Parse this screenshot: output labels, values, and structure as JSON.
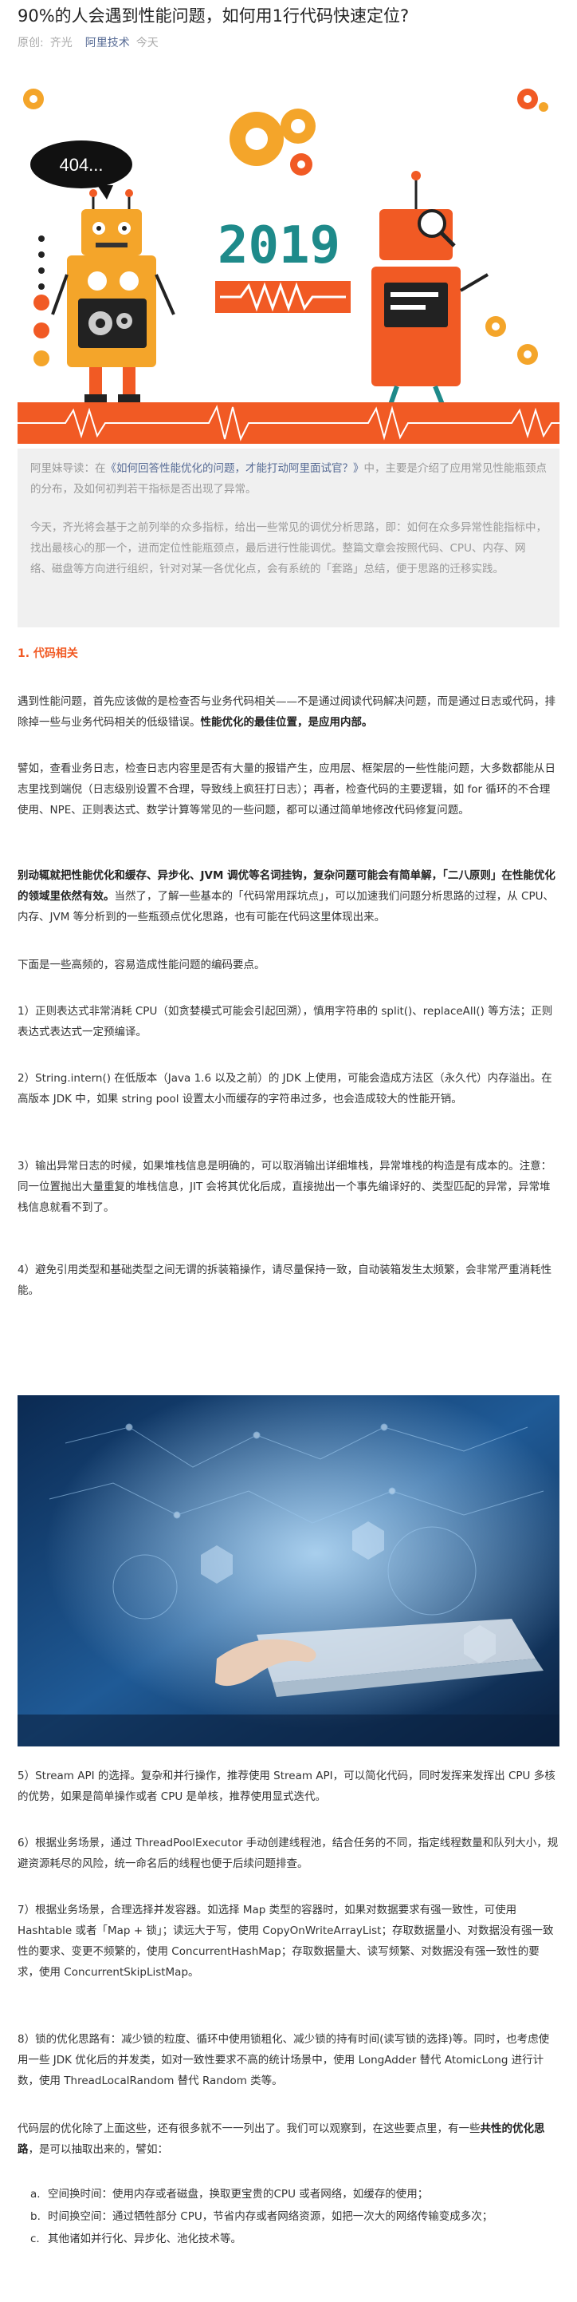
{
  "article": {
    "title": "90%的人会遇到性能问题，如何用1行代码快速定位?",
    "meta_label": "原创:",
    "author": "齐光",
    "account": "阿里技术",
    "date": "今天"
  },
  "hero": {
    "bubble": "404...",
    "year": "2019"
  },
  "intro": {
    "p1_prefix": "阿里妹导读：在",
    "p1_link": "《如何回答性能优化的问题，才能打动阿里面试官？》",
    "p1_suffix": "中，主要是介绍了应用常见性能瓶颈点的分布，及如何初判若干指标是否出现了异常。",
    "p2": "今天，齐光将会基于之前列举的众多指标，给出一些常见的调优分析思路，即：如何在众多异常性能指标中，找出最核心的那一个，进而定位性能瓶颈点，最后进行性能调优。整篇文章会按照代码、CPU、内存、网络、磁盘等方向进行组织，针对对某一各优化点，会有系统的「套路」总结，便于思路的迁移实践。"
  },
  "section1": {
    "heading": "1. 代码相关",
    "p1_a": "遇到性能问题，首先应该做的是检查否与业务代码相关——不是通过阅读代码解决问题，而是通过日志或代码，排除掉一些与业务代码相关的低级错误。",
    "p1_b": "性能优化的最佳位置，是应用内部。",
    "p2": "譬如，查看业务日志，检查日志内容里是否有大量的报错产生，应用层、框架层的一些性能问题，大多数都能从日志里找到端倪（日志级别设置不合理，导致线上疯狂打日志）；再者，检查代码的主要逻辑，如 for 循环的不合理使用、NPE、正则表达式、数学计算等常见的一些问题，都可以通过简单地修改代码修复问题。",
    "p3_a": "别动辄就把性能优化和缓存、异步化、JVM 调优等名词挂钩，复杂问题可能会有简单解，「二八原则」在性能优化的领域里依然有效。",
    "p3_b": "当然了，了解一些基本的「代码常用踩坑点」，可以加速我们问题分析思路的过程，从 CPU、内存、JVM 等分析到的一些瓶颈点优化思路，也有可能在代码这里体现出来。",
    "p4": "下面是一些高频的，容易造成性能问题的编码要点。",
    "i1": "1）正则表达式非常消耗 CPU（如贪婪模式可能会引起回溯），慎用字符串的 split()、replaceAll() 等方法；正则表达式表达式一定预编译。",
    "i2": "2）String.intern() 在低版本（Java 1.6 以及之前）的 JDK 上使用，可能会造成方法区（永久代）内存溢出。在高版本 JDK 中，如果 string pool 设置太小而缓存的字符串过多，也会造成较大的性能开销。",
    "i3": "3）输出异常日志的时候，如果堆栈信息是明确的，可以取消输出详细堆栈，异常堆栈的构造是有成本的。注意：同一位置抛出大量重复的堆栈信息，JIT 会将其优化后成，直接抛出一个事先编译好的、类型匹配的异常，异常堆栈信息就看不到了。",
    "i4": "4）避免引用类型和基础类型之间无谓的拆装箱操作，请尽量保持一致，自动装箱发生太频繁，会非常严重消耗性能。",
    "i5": "5）Stream API 的选择。复杂和并行操作，推荐使用 Stream API，可以简化代码，同时发挥来发挥出 CPU 多核的优势，如果是简单操作或者 CPU 是单核，推荐使用显式迭代。",
    "i6": "6）根据业务场景，通过 ThreadPoolExecutor 手动创建线程池，结合任务的不同，指定线程数量和队列大小，规避资源耗尽的风险，统一命名后的线程也便于后续问题排查。",
    "i7": "7）根据业务场景，合理选择并发容器。如选择 Map 类型的容器时，如果对数据要求有强一致性，可使用 Hashtable 或者「Map + 锁」；读远大于写，使用 CopyOnWriteArrayList；存取数据量小、对数据没有强一致性的要求、变更不频繁的，使用 ConcurrentHashMap；存取数据量大、读写频繁、对数据没有强一致性的要求，使用 ConcurrentSkipListMap。",
    "i8": "8）锁的优化思路有：减少锁的粒度、循环中使用锁粗化、减少锁的持有时间(读写锁的选择)等。同时，也考虑使用一些 JDK 优化后的并发类，如对一致性要求不高的统计场景中，使用 LongAdder 替代 AtomicLong 进行计数，使用 ThreadLocalRandom 替代 Random 类等。",
    "p5_a": "代码层的优化除了上面这些，还有很多就不一一列出了。我们可以观察到，在这些要点里，有一些",
    "p5_b": "共性的优化思路",
    "p5_c": "，是可以抽取出来的，譬如：",
    "list": [
      {
        "mk": "a.",
        "text": "空间换时间：使用内存或者磁盘，换取更宝贵的CPU 或者网络，如缓存的使用；"
      },
      {
        "mk": "b.",
        "text": "时间换空间：通过牺牲部分 CPU，节省内存或者网络资源，如把一次大的网络传输变成多次；"
      },
      {
        "mk": "c.",
        "text": "其他诸如并行化、异步化、池化技术等。"
      }
    ]
  }
}
